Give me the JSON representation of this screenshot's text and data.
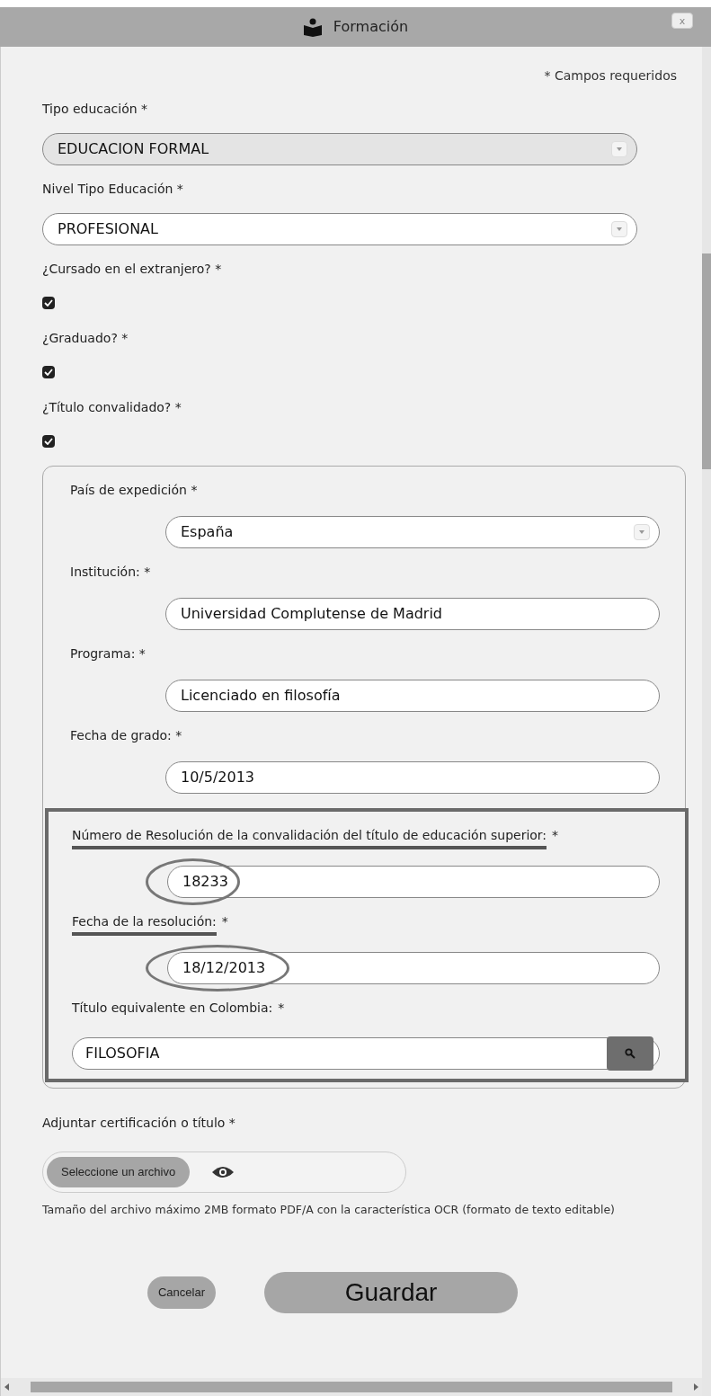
{
  "window": {
    "title": "Formación",
    "close": "x"
  },
  "required_note": "* Campos requeridos",
  "fields": [
    {
      "kind": "select",
      "label": "Tipo educación *",
      "value": "EDUCACION FORMAL",
      "disabled": true
    },
    {
      "kind": "select",
      "label": "Nivel Tipo Educación *",
      "value": "PROFESIONAL",
      "disabled": false
    },
    {
      "kind": "checkbox",
      "label": "¿Cursado en el extranjero? *",
      "checked": true
    },
    {
      "kind": "checkbox",
      "label": "¿Graduado? *",
      "checked": true
    },
    {
      "kind": "checkbox",
      "label": "¿Título convalidado? *",
      "checked": true
    }
  ],
  "panel_fields": [
    {
      "kind": "select",
      "label": "País de expedición *",
      "value": "España"
    },
    {
      "kind": "text",
      "label": "Institución: *",
      "value": "Universidad Complutense de Madrid"
    },
    {
      "kind": "text",
      "label": "Programa: *",
      "value": "Licenciado en filosofía"
    },
    {
      "kind": "text",
      "label": "Fecha de grado: *",
      "value": "10/5/2013"
    }
  ],
  "highlighted_fields": [
    {
      "kind": "text",
      "label": "Número de Resolución de la convalidación del título de educación superior:",
      "required": "*",
      "value": "18233",
      "marked": true
    },
    {
      "kind": "text",
      "label": "Fecha de la resolución:",
      "required": "*",
      "value": "18/12/2013",
      "marked": true
    },
    {
      "kind": "search",
      "label": "Título equivalente en Colombia:",
      "required": "*",
      "value": "FILOSOFIA",
      "marked": false
    }
  ],
  "attachment": {
    "label": "Adjuntar certificación o título *",
    "button": "Seleccione un archivo",
    "hint": "Tamaño del archivo máximo 2MB formato PDF/A con la característica OCR (formato de texto editable)"
  },
  "buttons": [
    {
      "kind": "secondary",
      "label": "Cancelar"
    },
    {
      "kind": "primary",
      "label": "Guardar"
    }
  ]
}
